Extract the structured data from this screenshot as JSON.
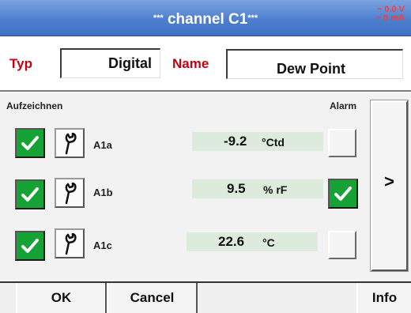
{
  "header": {
    "stars_left": "***",
    "title": "channel C1",
    "stars_right": "***",
    "voltage": "~ 0.0 V",
    "current": "~ 0 mA"
  },
  "fields": {
    "typ_label": "Typ",
    "typ_value": "Digital",
    "name_label": "Name",
    "name_value": "Dew Point"
  },
  "headings": {
    "record": "Aufzeichnen",
    "alarm": "Alarm"
  },
  "channels": [
    {
      "label": "A1a",
      "value": "-9.2",
      "unit": "°Ctd",
      "record": true,
      "alarm": false
    },
    {
      "label": "A1b",
      "value": "9.5",
      "unit": "% rF",
      "record": true,
      "alarm": true
    },
    {
      "label": "A1c",
      "value": "22.6",
      "unit": "°C",
      "record": true,
      "alarm": false
    }
  ],
  "next_label": ">",
  "footer": {
    "ok": "OK",
    "cancel": "Cancel",
    "info": "Info"
  },
  "colors": {
    "title_bar": "#4e7fcf",
    "label_red": "#c40012",
    "check_green": "#16a234",
    "value_bg": "#dcebdc",
    "readout_red": "#ff3b30"
  },
  "icons": {
    "check": "check-icon",
    "wrench": "wrench-icon"
  }
}
